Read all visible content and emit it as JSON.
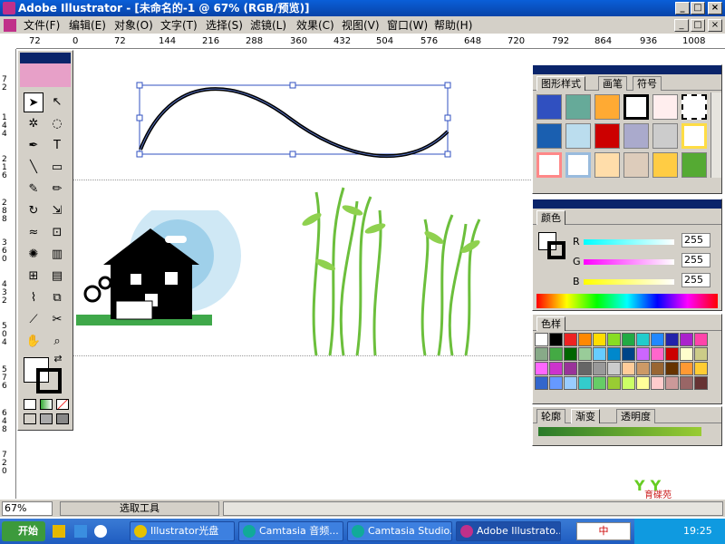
{
  "window": {
    "title": "Adobe Illustrator - [未命名的-1 @ 67% (RGB/预览)]",
    "min": "_",
    "max": "□",
    "close": "×"
  },
  "menu": [
    "文件(F)",
    "编辑(E)",
    "对象(O)",
    "文字(T)",
    "选择(S)",
    "滤镜(L)",
    "效果(C)",
    "视图(V)",
    "窗口(W)",
    "帮助(H)"
  ],
  "ruler": {
    "h_ticks": [
      "72",
      "0",
      "72",
      "144",
      "216",
      "288",
      "360",
      "432",
      "504",
      "576",
      "648",
      "720",
      "792",
      "864",
      "936",
      "1008"
    ],
    "v_ticks": [
      "72",
      "144",
      "216",
      "288",
      "360",
      "432",
      "504",
      "576",
      "648",
      "720"
    ]
  },
  "panels": {
    "styles": {
      "tabs": [
        "图形样式",
        "画笔",
        "符号"
      ]
    },
    "color": {
      "tab": "颜色",
      "r_label": "R",
      "g_label": "G",
      "b_label": "B",
      "r": "255",
      "g": "255",
      "b": "255"
    },
    "swatches": {
      "tab": "色样"
    },
    "gradient": {
      "tabs": [
        "轮廓",
        "渐变",
        "透明度"
      ]
    }
  },
  "status": {
    "zoom": "67%",
    "tool": "选取工具"
  },
  "taskbar": {
    "start": "开始",
    "tasks": [
      "Illustrator光盘",
      "Camtasia 音频...",
      "Camtasia Studio...",
      "Adobe Illustrato..."
    ],
    "clock": "19:25",
    "ime": "中"
  },
  "watermark": {
    "text": "育碟苑"
  },
  "colors": {
    "titlebar": "#0a5fd8",
    "panel": "#d4d0c8",
    "taskbar": "#1f5cc0"
  }
}
